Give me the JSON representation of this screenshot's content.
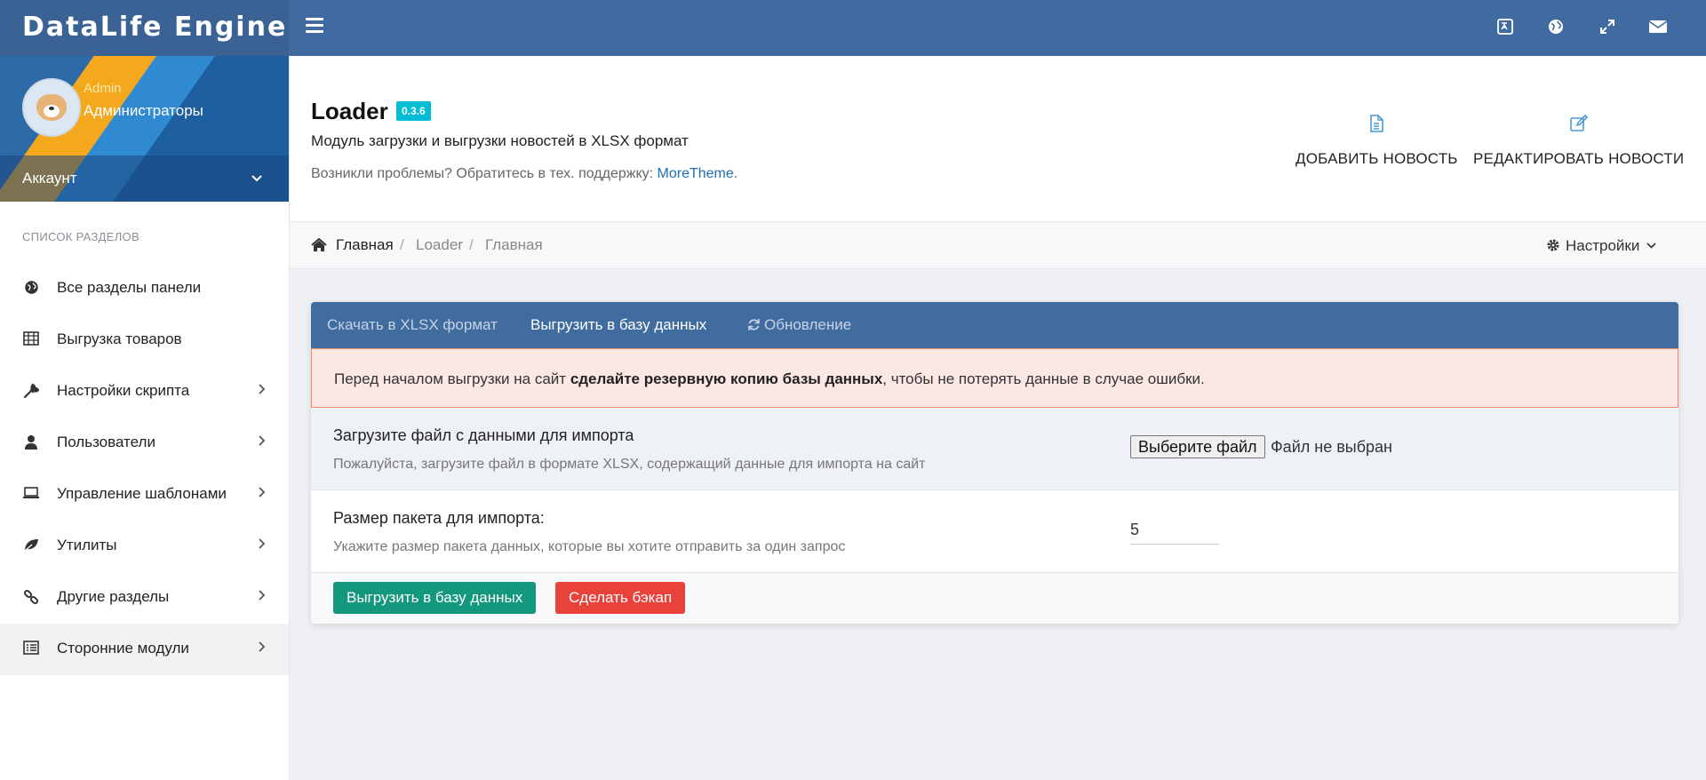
{
  "brand": {
    "title": "DataLife Engine"
  },
  "topbar": {
    "icons": [
      "hamburger-menu-icon",
      "translate-icon",
      "globe-icon",
      "expand-icon",
      "envelope-icon"
    ]
  },
  "sidebar": {
    "profile": {
      "name": "Admin",
      "group": "Администраторы"
    },
    "account_label": "Аккаунт",
    "section_title": "Список разделов",
    "items": [
      {
        "label": "Все разделы панели",
        "icon": "globe-icon",
        "has_children": false
      },
      {
        "label": "Выгрузка товаров",
        "icon": "table-icon",
        "has_children": false
      },
      {
        "label": "Настройки скрипта",
        "icon": "wrench-icon",
        "has_children": true
      },
      {
        "label": "Пользователи",
        "icon": "user-icon",
        "has_children": true
      },
      {
        "label": "Управление шаблонами",
        "icon": "laptop-icon",
        "has_children": true
      },
      {
        "label": "Утилиты",
        "icon": "leaf-icon",
        "has_children": true
      },
      {
        "label": "Другие разделы",
        "icon": "link-icon",
        "has_children": true
      },
      {
        "label": "Сторонние модули",
        "icon": "list-alt-icon",
        "has_children": true,
        "active": true
      }
    ]
  },
  "header": {
    "title": "Loader",
    "version": "0.3.6",
    "description": "Модуль загрузки и выгрузки новостей в XLSX формат",
    "support_text": "Возникли проблемы? Обратитесь в тех. поддержку: ",
    "support_link": "MoreTheme",
    "support_suffix": ".",
    "actions": [
      {
        "label": "ДОБАВИТЬ НОВОСТЬ",
        "icon": "file-icon"
      },
      {
        "label": "РЕДАКТИРОВАТЬ НОВОСТИ",
        "icon": "edit-icon"
      }
    ]
  },
  "breadcrumb": {
    "items": [
      "Главная",
      "Loader",
      "Главная"
    ],
    "separator": "/",
    "settings_label": "Настройки"
  },
  "card": {
    "tabs": [
      {
        "label": "Скачать в XLSX формат",
        "active": false
      },
      {
        "label": "Выгрузить в базу данных",
        "active": true
      },
      {
        "label": "Обновление",
        "active": false,
        "icon": "refresh-icon"
      }
    ],
    "alert": {
      "prefix": "Перед началом выгрузки на сайт ",
      "bold": "сделайте резервную копию базы данных",
      "suffix": ", чтобы не потерять данные в случае ошибки."
    },
    "file_row": {
      "title": "Загрузите файл с данными для импорта",
      "hint": "Пожалуйста, загрузите файл в формате XLSX, содержащий данные для импорта на сайт",
      "button_label": "Выберите файл",
      "status": "Файл не выбран"
    },
    "batch_row": {
      "title": "Размер пакета для импорта:",
      "hint": "Укажите размер пакета данных, которые вы хотите отправить за один запрос",
      "value": "5"
    },
    "buttons": {
      "upload_label": "Выгрузить в базу данных",
      "backup_label": "Сделать бэкап"
    }
  },
  "colors": {
    "topbar": "#406ba0",
    "tabs": "#416ca0",
    "accent_cyan": "#00bcd4",
    "button_green": "#13987d",
    "button_red": "#e8423a",
    "alert_bg": "#fbe7e3",
    "alert_border": "#ee8b62"
  }
}
